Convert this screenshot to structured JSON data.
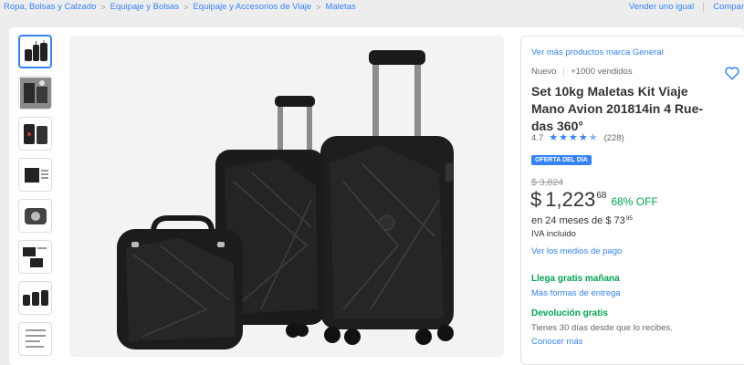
{
  "breadcrumb": {
    "items": [
      "Ropa, Bolsas y Calzado",
      "Equipaje y Bolsas",
      "Equipaje y Accesorios de Viaje",
      "Maletas"
    ],
    "separator": ">"
  },
  "top_links": {
    "sell": "Vender uno igual",
    "share": "Compar"
  },
  "product": {
    "brand_link": "Ver más productos marca General",
    "condition": "Nuevo",
    "cond_sep": "|",
    "sold": "+1000 vendidos",
    "title": "Set 10kg Maletas Kit Viaje Mano Avion 201814in 4 Rue-das 360°",
    "rating_value": "4.7",
    "rating_count": "(228)",
    "rating_stars": 4.7,
    "badge": "OFERTA DEL DÍA",
    "old_price": "$ 3,824",
    "currency": "$",
    "price_int": "1,223",
    "price_cents": "68",
    "discount": "68% OFF",
    "installments_prefix": "en 24 meses de $ 73",
    "installments_cents": "95",
    "iva": "IVA incluido",
    "payments_link": "Ver los medios de pago",
    "shipping_title": "Llega gratis mañana",
    "shipping_link": "Más formas de entrega",
    "return_title": "Devolución gratis",
    "return_text": "Tienes 30 días desde que lo recibes.",
    "return_link": "Conocer más"
  },
  "colors": {
    "accent": "#3483fa",
    "green": "#00a650",
    "bg": "#ededed"
  },
  "icons": {
    "favorite": "heart-icon",
    "star": "star-icon"
  }
}
